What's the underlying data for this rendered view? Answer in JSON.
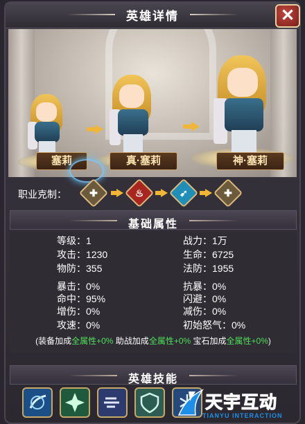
{
  "header": {
    "title": "英雄详情",
    "close_label": "✕"
  },
  "heroes": [
    {
      "name": "塞莉"
    },
    {
      "name": "真·塞莉"
    },
    {
      "name": "神·塞莉"
    }
  ],
  "class_counter": {
    "label": "职业克制："
  },
  "basic_attrs": {
    "title": "基础属性",
    "stats": [
      {
        "text": "等级：1"
      },
      {
        "text": "战力：1万"
      },
      {
        "text": "攻击：1230"
      },
      {
        "text": "生命：6725"
      },
      {
        "text": "物防：355"
      },
      {
        "text": "法防：1955"
      },
      {
        "text": "暴击：0%"
      },
      {
        "text": "抗暴：0%"
      },
      {
        "text": "命中：95%"
      },
      {
        "text": "闪避：0%"
      },
      {
        "text": "增伤：0%"
      },
      {
        "text": "减伤：0%"
      },
      {
        "text": "攻速：0%"
      },
      {
        "text": "初始怒气：0%"
      }
    ],
    "bonus": {
      "open": "(装备加成",
      "equip": "全属性+0%",
      "mid1": " 助战加成",
      "support": "全属性+0%",
      "mid2": " 宝石加成",
      "gem": "全属性+0%",
      "close": ")"
    }
  },
  "skills": {
    "title": "英雄技能"
  },
  "watermark": {
    "main": "天宇互动",
    "sub": "TIANYU INTERACTION"
  },
  "colors": {
    "accent_gold": "#e6d0a0",
    "highlight_green": "#4fe05a",
    "watermark_blue": "#1e8fe8"
  }
}
